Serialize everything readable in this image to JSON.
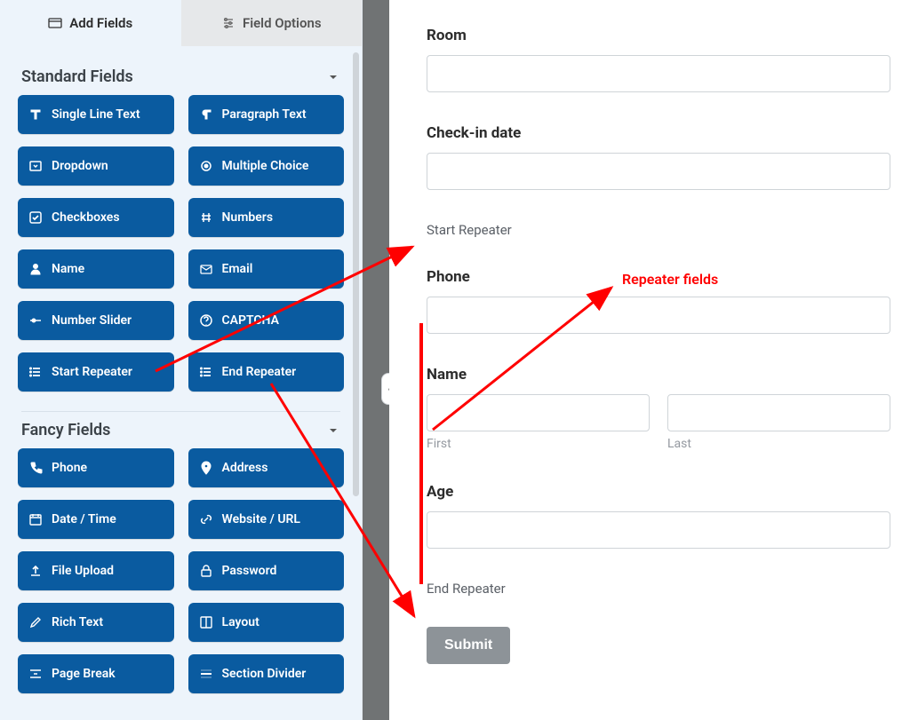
{
  "sidebar": {
    "tabs": {
      "add_fields": "Add Fields",
      "field_options": "Field Options"
    },
    "standard_header": "Standard Fields",
    "fancy_header": "Fancy Fields",
    "standard": [
      {
        "label": "Single Line Text",
        "icon": "text"
      },
      {
        "label": "Paragraph Text",
        "icon": "paragraph"
      },
      {
        "label": "Dropdown",
        "icon": "dropdown"
      },
      {
        "label": "Multiple Choice",
        "icon": "radio"
      },
      {
        "label": "Checkboxes",
        "icon": "check"
      },
      {
        "label": "Numbers",
        "icon": "hash"
      },
      {
        "label": "Name",
        "icon": "user"
      },
      {
        "label": "Email",
        "icon": "mail"
      },
      {
        "label": "Number Slider",
        "icon": "slider"
      },
      {
        "label": "CAPTCHA",
        "icon": "question"
      },
      {
        "label": "Start Repeater",
        "icon": "list"
      },
      {
        "label": "End Repeater",
        "icon": "list"
      }
    ],
    "fancy": [
      {
        "label": "Phone",
        "icon": "phone"
      },
      {
        "label": "Address",
        "icon": "pin"
      },
      {
        "label": "Date / Time",
        "icon": "calendar"
      },
      {
        "label": "Website / URL",
        "icon": "link"
      },
      {
        "label": "File Upload",
        "icon": "upload"
      },
      {
        "label": "Password",
        "icon": "lock"
      },
      {
        "label": "Rich Text",
        "icon": "edit"
      },
      {
        "label": "Layout",
        "icon": "layout"
      },
      {
        "label": "Page Break",
        "icon": "pagebreak"
      },
      {
        "label": "Section Divider",
        "icon": "divider"
      }
    ]
  },
  "preview": {
    "room_label": "Room",
    "checkin_label": "Check-in date",
    "start_repeater": "Start Repeater",
    "phone_label": "Phone",
    "name_label": "Name",
    "first_sub": "First",
    "last_sub": "Last",
    "age_label": "Age",
    "end_repeater": "End Repeater",
    "submit": "Submit"
  },
  "annotation": {
    "repeater_fields": "Repeater fields"
  }
}
